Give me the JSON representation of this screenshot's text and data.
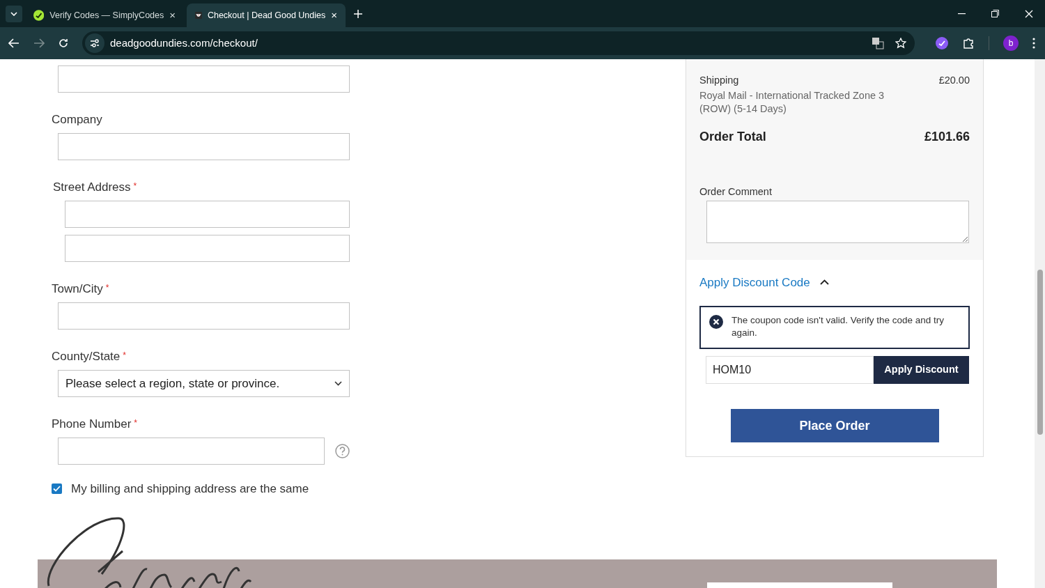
{
  "browser": {
    "tabs": [
      {
        "title": "Verify Codes — SimplyCodes",
        "close": "×",
        "selected": false
      },
      {
        "title": "Checkout | Dead Good Undies",
        "close": "×",
        "selected": true
      }
    ],
    "url": "deadgoodundies.com/checkout/",
    "profile_initial": "b"
  },
  "form": {
    "fields": [
      {
        "kind": "input"
      },
      {
        "kind": "input",
        "label": "Company"
      },
      {
        "kind": "address",
        "label": "Street Address",
        "required_mark": "*"
      },
      {
        "kind": "input",
        "label": "Town/City",
        "required_mark": "*"
      },
      {
        "kind": "select",
        "label": "County/State",
        "required_mark": "*",
        "value": "Please select a region, state or province."
      },
      {
        "kind": "phone",
        "label": "Phone Number",
        "required_mark": "*"
      }
    ],
    "same_address": {
      "label": "My billing and shipping address are the same",
      "checked": true
    }
  },
  "summary": {
    "shipping": {
      "label": "Shipping",
      "price": "£20.00",
      "method": "Royal Mail - International Tracked Zone 3 (ROW) (5-14 Days)"
    },
    "total": {
      "label": "Order Total",
      "price": "£101.66"
    },
    "comment_label": "Order Comment",
    "discount": {
      "title": "Apply Discount Code",
      "expanded": true,
      "error": "The coupon code isn't valid. Verify the code and try again.",
      "code": "HOM10",
      "button": "Apply Discount"
    },
    "place_order": "Place Order"
  }
}
